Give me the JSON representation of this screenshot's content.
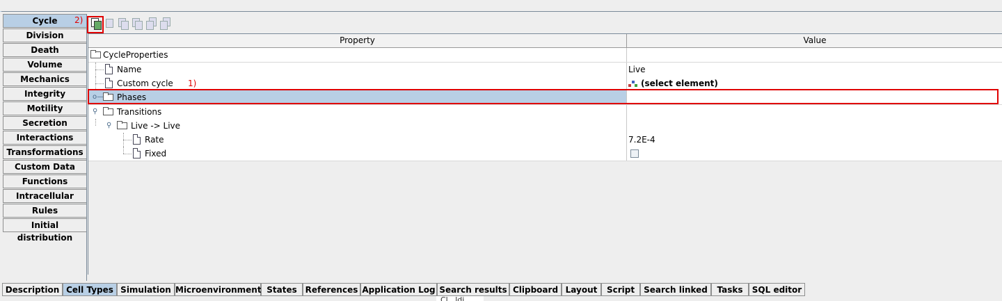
{
  "left_tabs": [
    "Cycle",
    "Division",
    "Death",
    "Volume",
    "Mechanics",
    "Integrity",
    "Motility",
    "Secretion",
    "Interactions",
    "Transformations",
    "Custom Data",
    "Functions",
    "Intracellular",
    "Rules",
    "Initial distribution"
  ],
  "active_left_tab": "Cycle",
  "annotations": {
    "step1": "1)",
    "step2": "2)",
    "color": "#e00000"
  },
  "table": {
    "headers": {
      "property": "Property",
      "value": "Value"
    },
    "rows": [
      {
        "label": "CycleProperties",
        "value": ""
      },
      {
        "label": "Name",
        "value": "Live"
      },
      {
        "label": "Custom cycle",
        "value": "(select element)"
      },
      {
        "label": "Phases",
        "value": ""
      },
      {
        "label": "Transitions",
        "value": ""
      },
      {
        "label": "Live -> Live",
        "value": ""
      },
      {
        "label": "Rate",
        "value": "7.2E-4"
      },
      {
        "label": "Fixed",
        "value": ""
      }
    ],
    "fixed_checked": false
  },
  "bottom_tabs": [
    "Description",
    "Cell Types",
    "Simulation",
    "Microenvironment",
    "States",
    "References",
    "Application Log",
    "Search results",
    "Clipboard",
    "Layout",
    "Script",
    "Search linked",
    "Tasks",
    "SQL editor"
  ],
  "active_bottom_tab": "Cell Types",
  "tooltip_text": "Cl...ldi...",
  "colors": {
    "selected": "#b8cfe5",
    "background": "#eeeeee"
  }
}
